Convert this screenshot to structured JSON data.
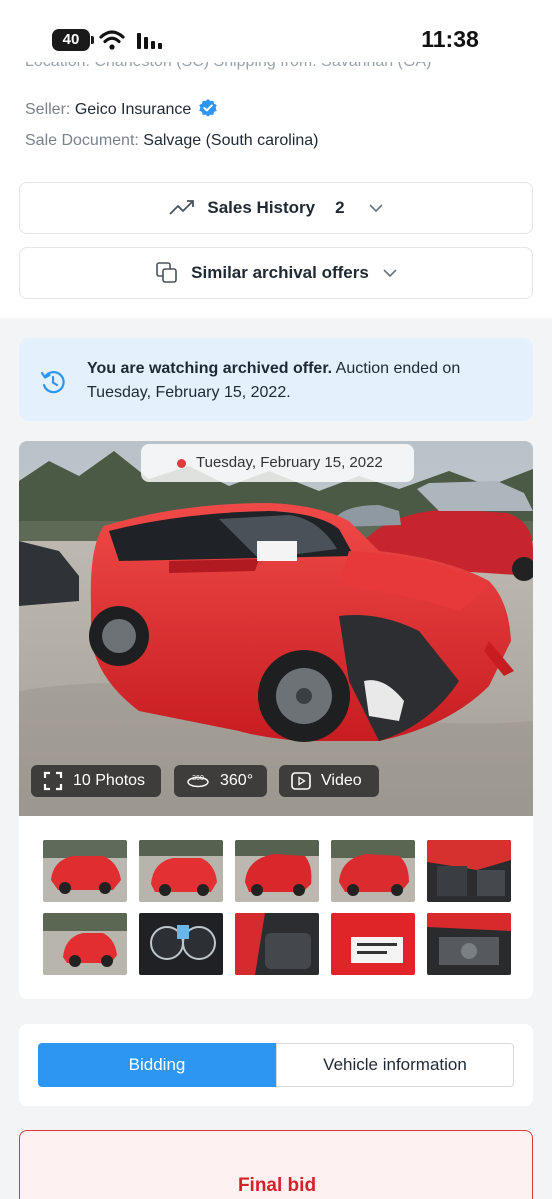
{
  "status_bar": {
    "battery": "40",
    "time": "11:38"
  },
  "details": {
    "partial_row": "Location: Charleston (SC)   Shipping from: Savannah (GA)",
    "seller_label": "Seller:",
    "seller_value": "Geico Insurance",
    "sale_doc_label": "Sale Document:",
    "sale_doc_value": "Salvage (South carolina)"
  },
  "sales_history": {
    "label": "Sales History",
    "count": "2"
  },
  "similar_offers": {
    "label": "Similar archival offers"
  },
  "notice": {
    "bold": "You are watching archived offer.",
    "text": " Auction ended on Tuesday, February 15, 2022."
  },
  "gallery": {
    "date": "Tuesday, February 15, 2022",
    "photos_label": "10 Photos",
    "view360_label": "360°",
    "video_label": "Video",
    "thumbnails": [
      "front-3q-damage",
      "front-left-damage",
      "rear-left",
      "rear-right",
      "interior-front",
      "front-overview",
      "instrument-cluster",
      "rear-seats",
      "door-sticker",
      "engine-bay"
    ]
  },
  "tabs": {
    "bidding": "Bidding",
    "vehicle_info": "Vehicle information"
  },
  "final_bid": {
    "label": "Final bid"
  },
  "colors": {
    "accent": "#2d96f3",
    "alert": "#e0393e",
    "notice_bg": "#e4f0fc"
  }
}
